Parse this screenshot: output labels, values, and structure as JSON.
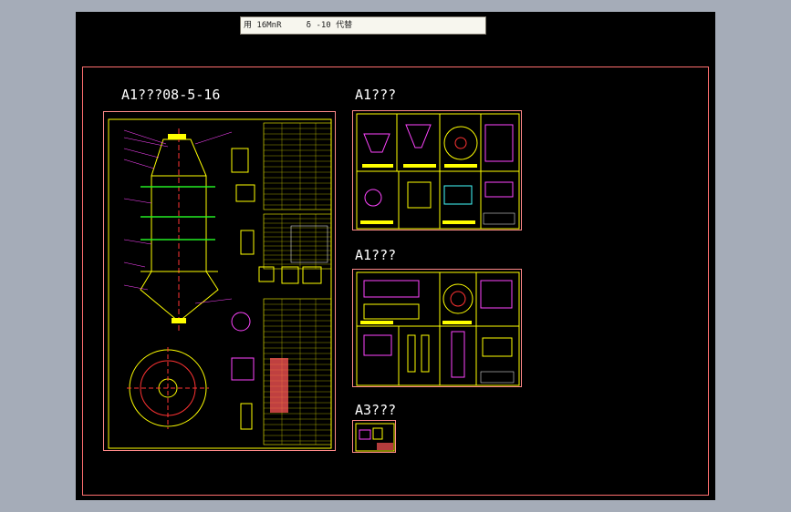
{
  "note_bar": {
    "text": "用 16MnR     δ -10 代替"
  },
  "sheets": [
    {
      "label": "A1???08-5-16"
    },
    {
      "label": "A1???"
    },
    {
      "label": "A1???"
    },
    {
      "label": "A3???"
    }
  ],
  "colors": {
    "canvas": "#000000",
    "desktop": "#a5acb8",
    "frame": "#ff6f6f",
    "border_yellow": "#ffff00",
    "green": "#22ee22",
    "magenta": "#ff44ff",
    "red": "#ff3333",
    "white": "#ffffff",
    "cyan": "#44ffff"
  }
}
